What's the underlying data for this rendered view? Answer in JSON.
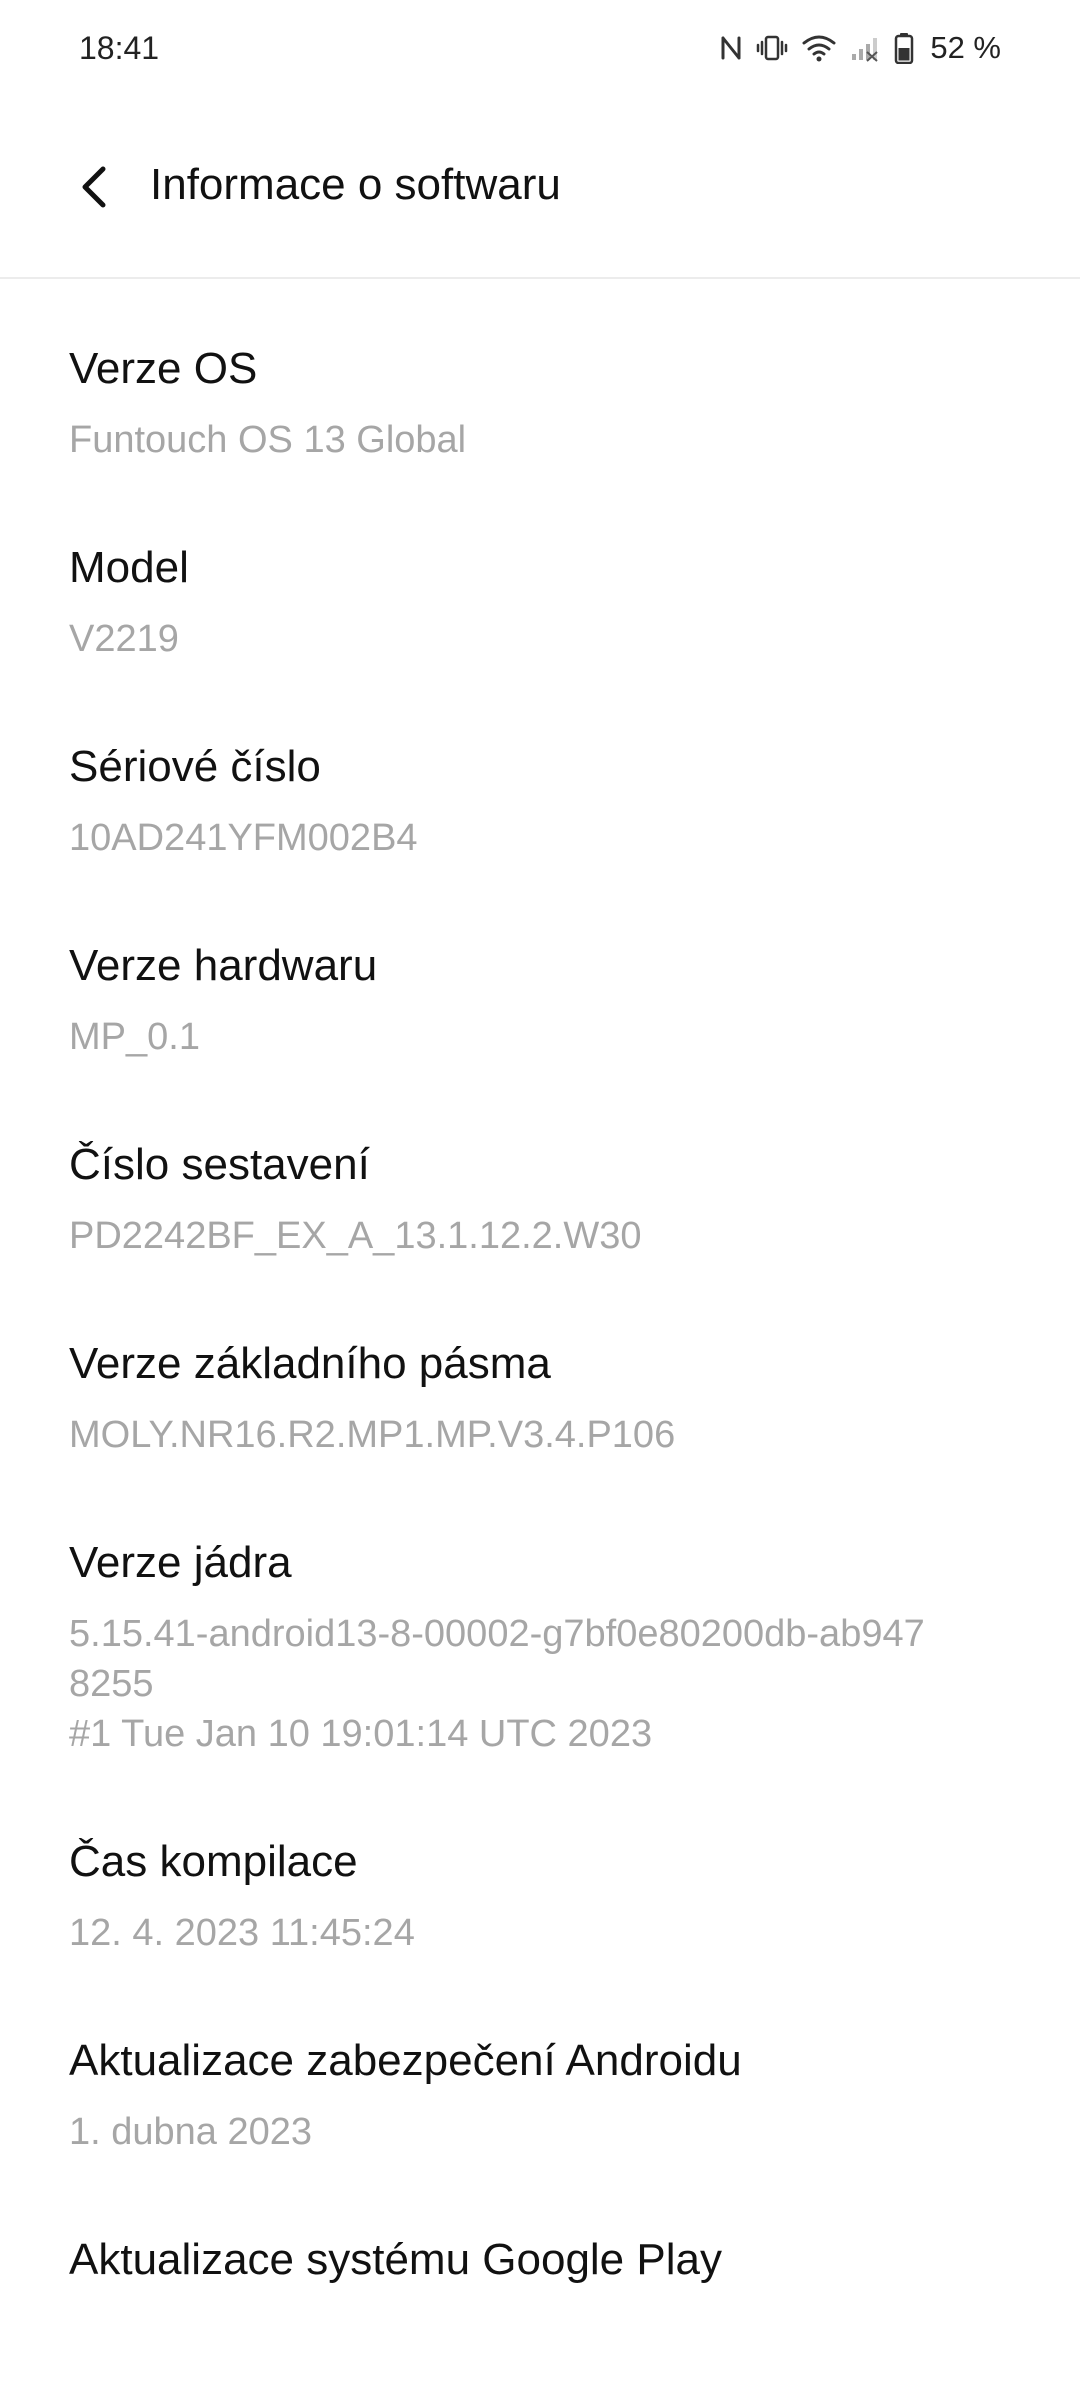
{
  "status_bar": {
    "time": "18:41",
    "battery_percent": "52 %",
    "icons": [
      "nfc-icon",
      "vibrate-icon",
      "wifi-icon",
      "no-signal-icon",
      "battery-icon"
    ]
  },
  "header": {
    "title": "Informace o softwaru",
    "back_icon": "chevron-left-icon"
  },
  "items": [
    {
      "title": "Verze OS",
      "value": "Funtouch OS 13 Global"
    },
    {
      "title": "Model",
      "value": "V2219"
    },
    {
      "title": "Sériové číslo",
      "value": "10AD241YFM002B4"
    },
    {
      "title": "Verze hardwaru",
      "value": "MP_0.1"
    },
    {
      "title": "Číslo sestavení",
      "value": "PD2242BF_EX_A_13.1.12.2.W30"
    },
    {
      "title": "Verze základního pásma",
      "value": "MOLY.NR16.R2.MP1.MP.V3.4.P106"
    },
    {
      "title": "Verze jádra",
      "value": "5.15.41-android13-8-00002-g7bf0e80200db-ab947\n8255\n#1 Tue Jan 10 19:01:14 UTC 2023"
    },
    {
      "title": "Čas kompilace",
      "value": "12. 4. 2023 11:45:24"
    },
    {
      "title": "Aktualizace zabezpečení Androidu",
      "value": "1. dubna 2023"
    },
    {
      "title": "Aktualizace systému Google Play",
      "value": ""
    }
  ]
}
